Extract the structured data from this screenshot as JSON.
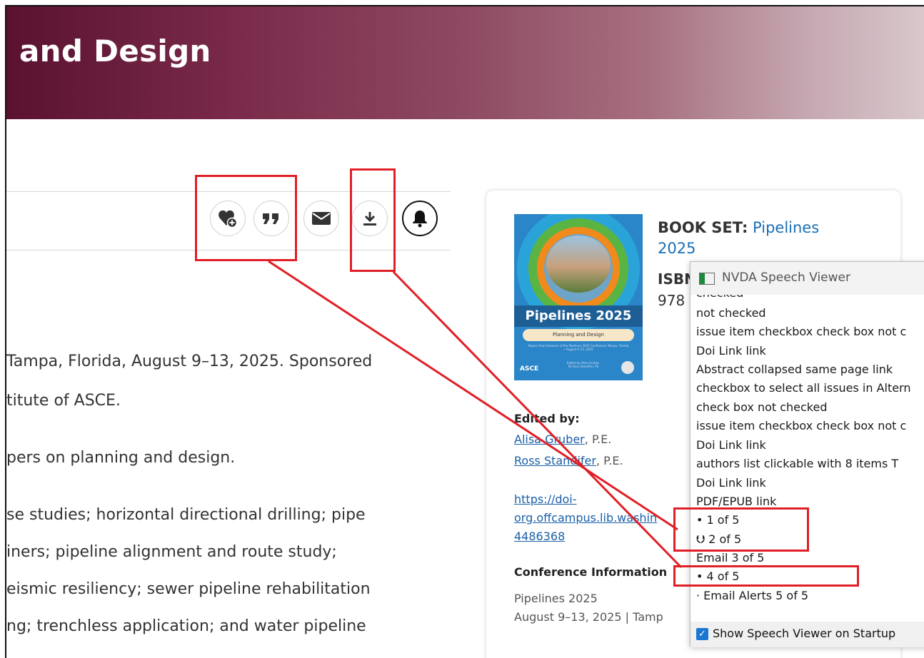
{
  "hero": {
    "title": "and Design"
  },
  "toolbar": {
    "favorite_icon": "heart-plus-icon",
    "cite_icon": "quote-icon",
    "email_icon": "envelope-icon",
    "download_icon": "download-icon",
    "alert_icon": "bell-icon"
  },
  "body_lines": [
    "Tampa, Florida, August 9–13, 2025. Sponsored",
    "titute of ASCE.",
    "pers on planning and design.",
    "se studies; horizontal directional drilling; pipe",
    "iners; pipeline alignment and route study;",
    "eismic resiliency; sewer pipeline rehabilitation",
    "ng; trenchless application; and water pipeline"
  ],
  "card": {
    "cover": {
      "title": "Pipelines 2025",
      "subtitle": "Planning and Design",
      "small_text": "Papers from Sessions of the Pipelines 2025 Conference Tampa, Florida • August 9–13, 2025",
      "publisher": "ASCE",
      "editors": "Edited by Alisa Gruber, PE Ross Standifer, PE"
    },
    "book_set_label": "BOOK SET:",
    "book_set_value": "Pipelines 2025",
    "isbn_label": "ISBN",
    "isbn_value": "978",
    "edited_by_label": "Edited by:",
    "editors": [
      {
        "name": "Alisa Gruber",
        "suffix": ", P.E."
      },
      {
        "name": "Ross Standifer",
        "suffix": ", P.E."
      }
    ],
    "doi_lines": [
      "https://doi-",
      "org.offcampus.lib.washin",
      "4486368"
    ],
    "conference_label": "Conference Information",
    "conference_name": "Pipelines 2025",
    "conference_dates": "August 9–13, 2025 | Tamp"
  },
  "nvda": {
    "title": "NVDA Speech Viewer",
    "cut_top": "checked",
    "lines": [
      "not checked",
      "issue item checkbox  check box  not c",
      "Doi Link  link",
      "Abstract  collapsed  same page  link",
      "checkbox to select all issues in Altern",
      "check box  not checked",
      "issue item checkbox  check box  not c",
      "Doi Link  link",
      "authors  list  clickable  with 8 items  T",
      "Doi Link  link",
      "PDF/EPUB  link",
      "•  1 of 5",
      "⮋  2 of 5",
      "Email  3 of 5",
      "•  4 of 5",
      "·  Email Alerts  5 of 5"
    ],
    "show_on_startup": "Show Speech Viewer on Startup"
  },
  "colors": {
    "annotation_red": "#e01f26",
    "link_blue": "#1a6fb5",
    "hero_dark": "#5a1230"
  }
}
